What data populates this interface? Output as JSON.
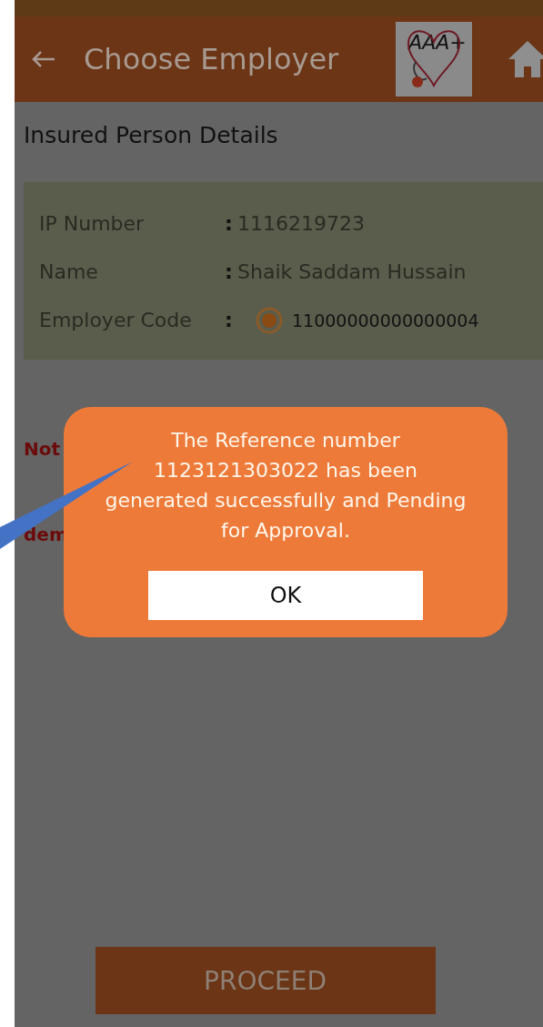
{
  "app_bar": {
    "title": "Choose Employer",
    "logo_text": "AAA+"
  },
  "section_title": "Insured Person Details",
  "details": [
    {
      "label": "IP Number",
      "separator": ":",
      "value": "1116219723",
      "kind": "text"
    },
    {
      "label": "Name",
      "separator": ":",
      "value": "Shaik Saddam Hussain",
      "kind": "text"
    },
    {
      "label": "Employer Code",
      "separator": ":",
      "value": "11000000000000004",
      "kind": "radio",
      "selected": true
    }
  ],
  "notes": [
    "Not",
    "dem"
  ],
  "dialog": {
    "message": "The Reference number 1123121303022 has been generated successfully and Pending for Approval.",
    "ok_button": "OK"
  },
  "proceed_button": "PROCEED"
}
